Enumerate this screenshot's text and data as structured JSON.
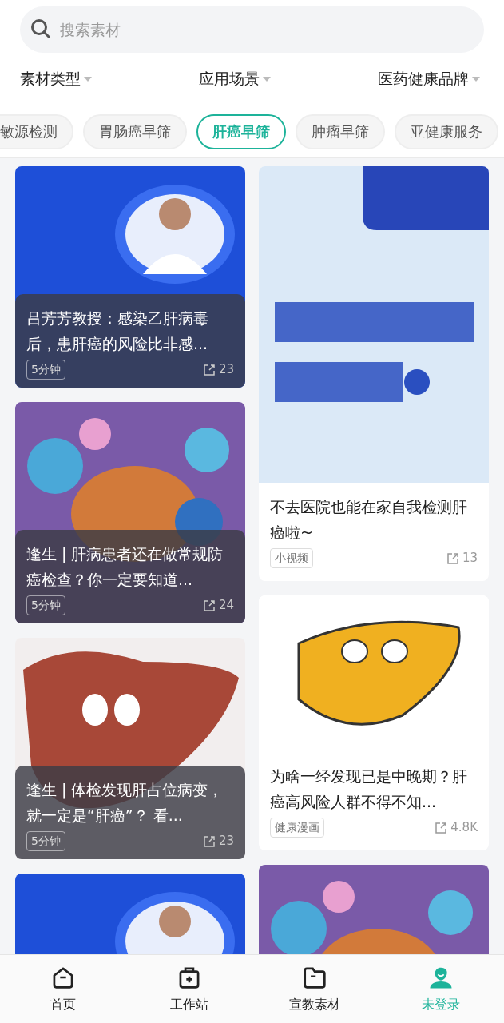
{
  "search": {
    "placeholder": "搜索素材"
  },
  "filters": [
    {
      "label": "素材类型"
    },
    {
      "label": "应用场景"
    },
    {
      "label": "医药健康品牌"
    }
  ],
  "chips": [
    {
      "label": "敏源检测",
      "selected": false
    },
    {
      "label": "胃肠癌早筛",
      "selected": false
    },
    {
      "label": "肝癌早筛",
      "selected": true
    },
    {
      "label": "肿瘤早筛",
      "selected": false
    },
    {
      "label": "亚健康服务",
      "selected": false
    }
  ],
  "feed": {
    "columns": [
      {
        "cards": [
          {
            "kind": "overlay",
            "title": "吕芳芳教授：感染乙肝病毒后，患肝癌的风险比非感...",
            "tag": "5分钟",
            "shares": "23"
          },
          {
            "kind": "overlay",
            "title": "逢生 | 肝病患者还在做常规防癌检查？你一定要知道...",
            "tag": "5分钟",
            "shares": "24"
          },
          {
            "kind": "overlay",
            "title": "逢生 | 体检发现肝占位病变，就一定是“肝癌”？ 看...",
            "tag": "5分钟",
            "shares": "23"
          },
          {
            "kind": "image_only"
          }
        ]
      },
      {
        "cards": [
          {
            "kind": "plain",
            "title": "不去医院也能在家自我检测肝癌啦~",
            "tag": "小视频",
            "shares": "13"
          },
          {
            "kind": "plain",
            "title": "为啥一经发现已是中晚期？肝癌高风险人群不得不知...",
            "tag": "健康漫画",
            "shares": "4.8K"
          },
          {
            "kind": "image_only"
          }
        ]
      }
    ]
  },
  "tabbar": [
    {
      "label": "首页",
      "selected": false
    },
    {
      "label": "工作站",
      "selected": false
    },
    {
      "label": "宣教素材",
      "selected": false
    },
    {
      "label": "未登录",
      "selected": true
    }
  ]
}
